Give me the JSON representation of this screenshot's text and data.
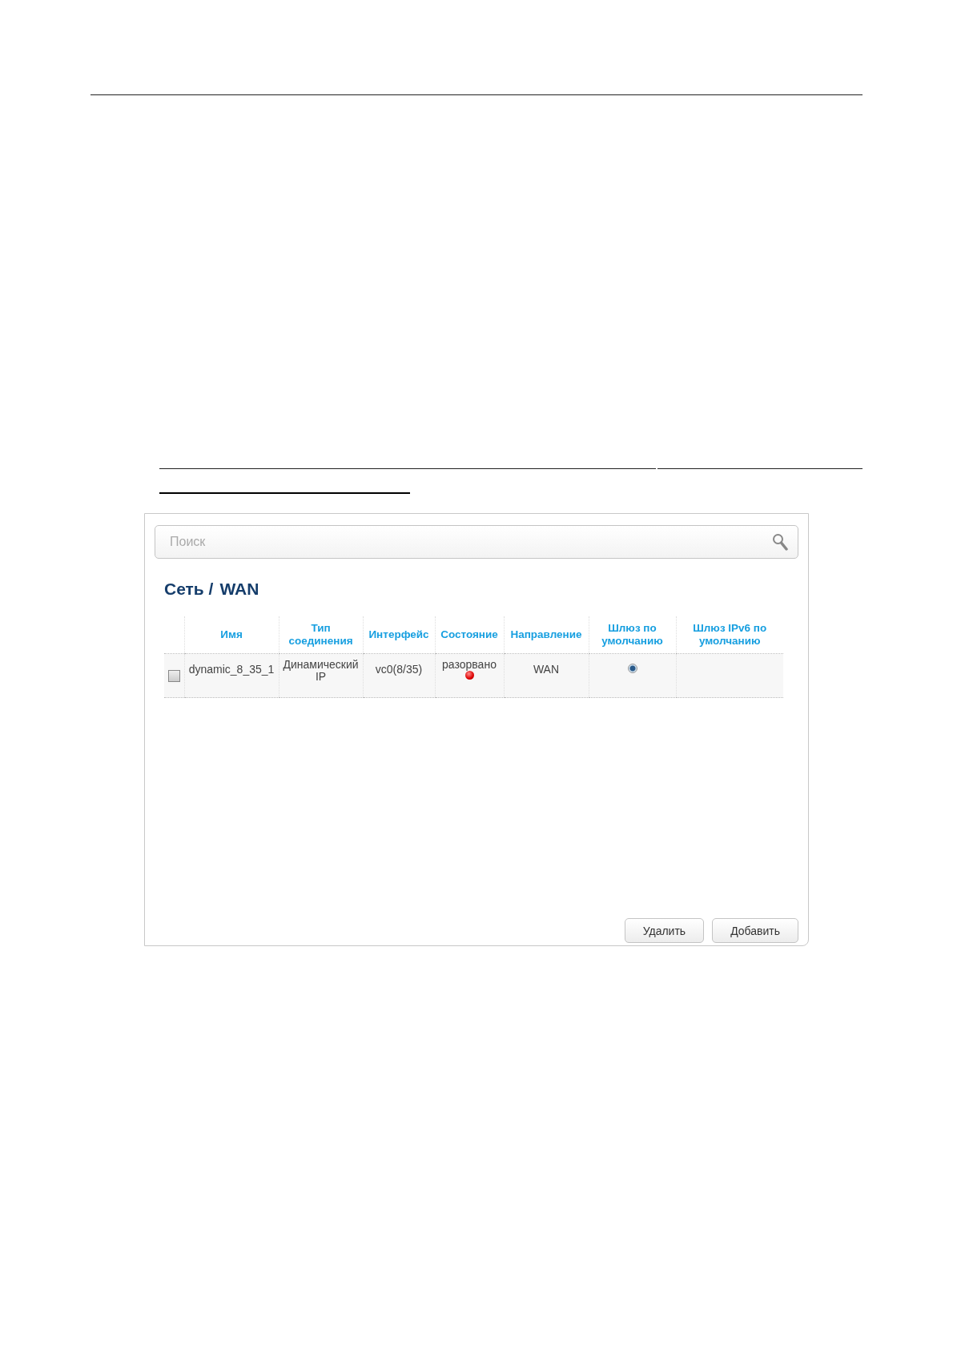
{
  "search": {
    "placeholder": "Поиск"
  },
  "breadcrumb": [
    "Сеть /",
    "WAN"
  ],
  "table": {
    "columns": [
      "Имя",
      "Тип соединения",
      "Интерфейс",
      "Состояние",
      "Направление",
      "Шлюз по умолчанию",
      "Шлюз IPv6 по умолчанию"
    ],
    "rows": [
      {
        "checked": false,
        "name": "dynamic_8_35_1",
        "type": "Динамический IP",
        "interface": "vc0(8/35)",
        "state": "разорвано",
        "connected": false,
        "direction": "WAN",
        "default_gateway": true
      }
    ]
  },
  "buttons": [
    "Удалить",
    "Добавить"
  ]
}
